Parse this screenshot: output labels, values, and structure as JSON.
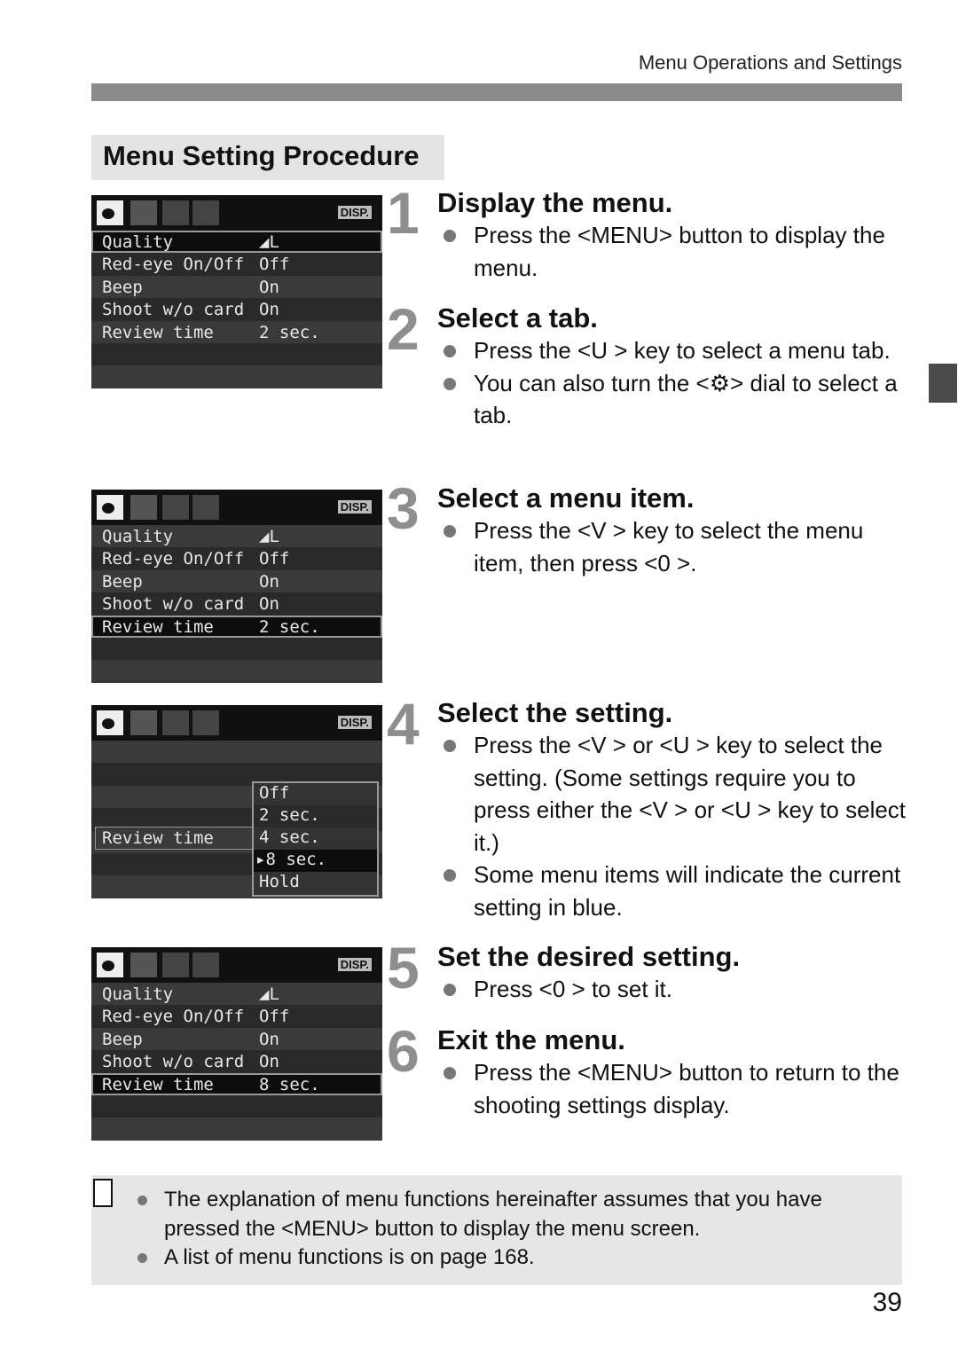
{
  "header": {
    "section": "Menu Operations and Settings"
  },
  "section_title": "Menu Setting Procedure",
  "lcd_common": {
    "disp_label": "DISP."
  },
  "lcd1": {
    "rows": [
      {
        "label": "Quality",
        "value": "◢L"
      },
      {
        "label": "Red-eye On/Off",
        "value": "Off"
      },
      {
        "label": "Beep",
        "value": "On"
      },
      {
        "label": "Shoot w/o card",
        "value": "On"
      },
      {
        "label": "Review time",
        "value": "2 sec."
      }
    ],
    "selected": "Quality"
  },
  "lcd2": {
    "rows": [
      {
        "label": "Quality",
        "value": "◢L"
      },
      {
        "label": "Red-eye On/Off",
        "value": "Off"
      },
      {
        "label": "Beep",
        "value": "On"
      },
      {
        "label": "Shoot w/o card",
        "value": "On"
      },
      {
        "label": "Review time",
        "value": "2 sec."
      }
    ],
    "selected": "Review time"
  },
  "lcd3": {
    "item": "Review time",
    "options": [
      "Off",
      "2 sec.",
      "4 sec.",
      "▸8 sec.",
      "Hold"
    ],
    "selected": "8 sec."
  },
  "lcd4": {
    "rows": [
      {
        "label": "Quality",
        "value": "◢L"
      },
      {
        "label": "Red-eye On/Off",
        "value": "Off"
      },
      {
        "label": "Beep",
        "value": "On"
      },
      {
        "label": "Shoot w/o card",
        "value": "On"
      },
      {
        "label": "Review time",
        "value": "8 sec."
      }
    ],
    "selected": "Review time"
  },
  "steps": [
    {
      "num": "1",
      "title": "Display the menu.",
      "bullets": [
        "Press the <MENU> button to display the menu."
      ]
    },
    {
      "num": "2",
      "title": "Select a tab.",
      "bullets": [
        "Press the <U     > key to select a menu tab.",
        "You can also turn the <⚙> dial to select a tab."
      ]
    },
    {
      "num": "3",
      "title": "Select a menu item.",
      "bullets": [
        "Press the <V     > key to select the menu item, then press <0    >."
      ]
    },
    {
      "num": "4",
      "title": "Select the setting.",
      "bullets": [
        "Press the <V     > or <U     > key to select the setting. (Some settings require you to press either the <V     > or <U     > key to select it.)",
        "Some menu items will indicate the current setting in blue."
      ]
    },
    {
      "num": "5",
      "title": "Set the desired setting.",
      "bullets": [
        "Press <0    > to set it."
      ]
    },
    {
      "num": "6",
      "title": "Exit the menu.",
      "bullets": [
        "Press the <MENU> button to return to the shooting settings display."
      ]
    }
  ],
  "note": {
    "bullets": [
      "The explanation of menu functions hereinafter assumes that you have pressed the <MENU> button to display the menu screen.",
      "A list of menu functions is on page 168."
    ]
  },
  "page_number": "39"
}
